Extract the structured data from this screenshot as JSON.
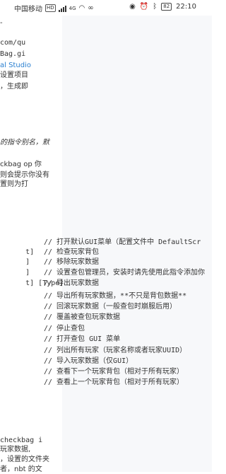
{
  "status_bar": {
    "carrier": "中国移动",
    "hd": "HD",
    "signal_label": "4G",
    "time": "22:10",
    "battery": "82"
  },
  "doc": {
    "top_fragment": "-",
    "url_line1": "com/qu",
    "url_line2": "Bag.gi",
    "vs_link": "al Studio",
    "line_setup": "设置项目",
    "line_gen": "，生成即",
    "alias_note": "的指令别名，默",
    "p1a": "ckbag op 你",
    "p1b": "则会提示你没有",
    "p2": "置则为打",
    "cmd_rows": [
      {
        "left": "",
        "comment": "// 打开默认GUI菜单（配置文件中 DefaultScr"
      },
      {
        "left": "t]",
        "comment": "// 检查玩家背包"
      },
      {
        "left": "]",
        "comment": "// 移除玩家数据"
      },
      {
        "left": "]",
        "comment": "// 设置查包管理员，安装时请先使用此指令添加你"
      },
      {
        "left": "t] [Type]",
        "comment": "// 导出玩家数据"
      },
      {
        "left": "",
        "comment": "// 导出所有玩家数据，**不只是背包数据**"
      },
      {
        "left": "",
        "comment": "// 回滚玩家数据（一般查包时崩服后用）"
      },
      {
        "left": "",
        "comment": "// 覆盖被查包玩家数据"
      },
      {
        "left": "",
        "comment": "// 停止查包"
      },
      {
        "left": "",
        "comment": "// 打开查包 GUI 菜单"
      },
      {
        "left": "",
        "comment": "// 列出所有玩家（玩家名称或者玩家UUID）"
      },
      {
        "left": "",
        "comment": "// 导入玩家数据（仅GUI）"
      },
      {
        "left": "",
        "comment": "// 查看下一个玩家背包（相对于所有玩家）"
      },
      {
        "left": "",
        "comment": "// 查看上一个玩家背包（相对于所有玩家）"
      }
    ],
    "bottom1": "checkbag i",
    "bottom2": "玩家数据,",
    "bottom3": "，设置的文件夹",
    "bottom4": "者，nbt 的文"
  }
}
